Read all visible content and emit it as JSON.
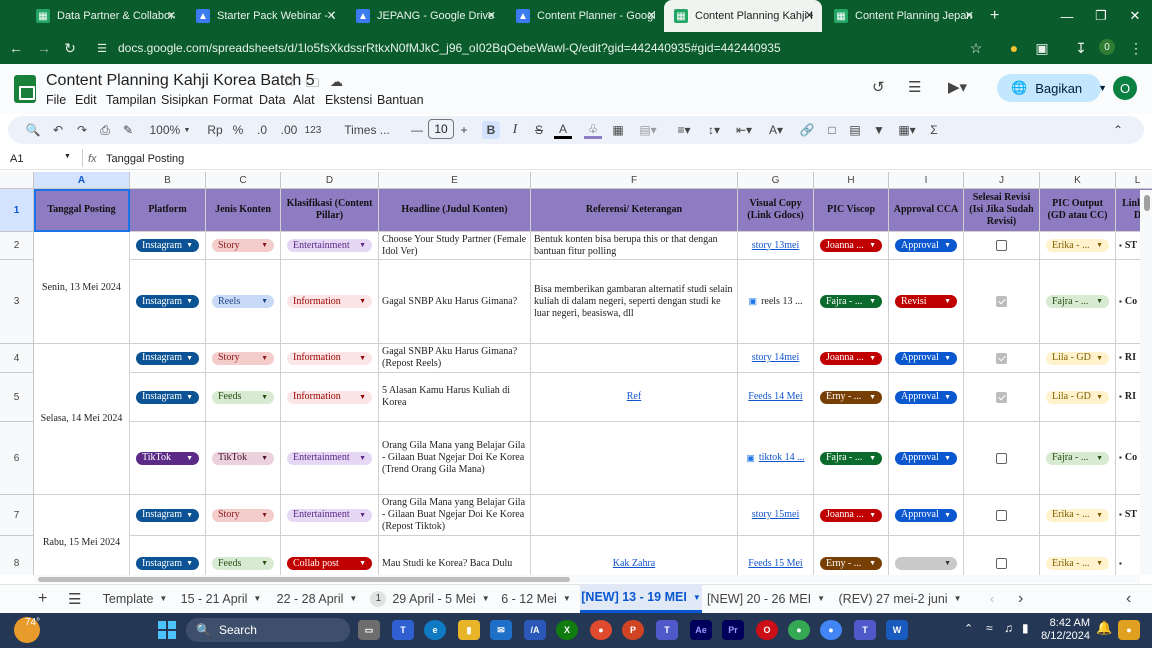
{
  "browser": {
    "tabs": [
      {
        "title": "Data Partner & Collaborat",
        "active": false,
        "icon": "sheets-icon"
      },
      {
        "title": "Starter Pack Webinar - Go",
        "active": false,
        "icon": "drive-icon"
      },
      {
        "title": "JEPANG - Google Drive",
        "active": false,
        "icon": "drive-icon"
      },
      {
        "title": "Content Planner - Google",
        "active": false,
        "icon": "drive-icon"
      },
      {
        "title": "Content Planning Kahji Ko",
        "active": true,
        "icon": "sheets-icon"
      },
      {
        "title": "Content Planning Jepang",
        "active": false,
        "icon": "sheets-icon"
      }
    ],
    "new_tab_symbol": "+",
    "url": "docs.google.com/spreadsheets/d/1lo5fsXkdssrRtkxN0fMJkC_j96_oI02BqOebeWawl-Q/edit?gid=442440935#gid=442440935",
    "profile_initial": "0"
  },
  "doc": {
    "title": "Content Planning Kahji Korea Batch 5",
    "menu": [
      "File",
      "Edit",
      "Tampilan",
      "Sisipkan",
      "Format",
      "Data",
      "Alat",
      "Ekstensi",
      "Bantuan"
    ],
    "share_label": "Bagikan",
    "avatar_initial": "O"
  },
  "toolbar": {
    "zoom": "100%",
    "currency": "Rp",
    "percent": "%",
    "dec_decrease": ".0",
    "dec_increase": ".00",
    "number_format": "123",
    "font": "Times ...",
    "font_size": "10"
  },
  "formula_bar": {
    "cell_ref": "A1",
    "fx": "fx",
    "value": "Tanggal Posting"
  },
  "grid": {
    "columns": [
      "A",
      "B",
      "C",
      "D",
      "E",
      "F",
      "G",
      "H",
      "I",
      "J",
      "K",
      "L"
    ],
    "row_numbers": [
      "1",
      "2",
      "3",
      "4",
      "5",
      "6",
      "7",
      "8"
    ],
    "headers": [
      "Tanggal Posting",
      "Platform",
      "Jenis Konten",
      "Klasifikasi (Content Pillar)",
      "Headline (Judul Konten)",
      "Referensi/ Keterangan",
      "Visual Copy (Link Gdocs)",
      "PIC Viscop",
      "Approval CCA",
      "Selesai Revisi (Isi Jika Sudah Revisi)",
      "PIC Output (GD atau CC)",
      "Link G D"
    ],
    "dates": [
      "Senin, 13 Mei 2024",
      "Selasa, 14 Mei 2024",
      "Rabu, 15 Mei 2024"
    ],
    "rows": [
      {
        "platform": "Instagram",
        "jenis": "Story",
        "klas": "Entertainment",
        "headline": "Choose Your Study Partner (Female Idol Ver)",
        "ref": "Bentuk konten bisa berupa this or that dengan bantuan fitur polling",
        "visual": "story 13mei",
        "pic": "Joanna ...",
        "approval": "Approval",
        "done": false,
        "output": "Erika - ...",
        "link": "ST"
      },
      {
        "platform": "Instagram",
        "jenis": "Reels",
        "klas": "Information",
        "headline": "Gagal SNBP Aku Harus Gimana?",
        "ref": "Bisa memberikan gambaran alternatif studi selain kuliah di dalam negeri, seperti dengan studi ke luar negeri, beasiswa, dll",
        "visual": "reels 13 ...",
        "pic": "Fajra - ...",
        "approval": "Revisi",
        "done": true,
        "output": "Fajra - ...",
        "link": "Co"
      },
      {
        "platform": "Instagram",
        "jenis": "Story",
        "klas": "Information",
        "headline": "Gagal SNBP Aku Harus Gimana? (Repost Reels)",
        "ref": "",
        "visual": "story 14mei",
        "pic": "Joanna ...",
        "approval": "Approval",
        "done": true,
        "output": "Lila - GD",
        "link": "RI"
      },
      {
        "platform": "Instagram",
        "jenis": "Feeds",
        "klas": "Information",
        "headline": "5 Alasan Kamu Harus Kuliah di Korea",
        "ref": "Ref",
        "visual": "Feeds 14 Mei",
        "pic": "Erny - ...",
        "approval": "Approval",
        "done": true,
        "output": "Lila - GD",
        "link": "RI"
      },
      {
        "platform": "TikTok",
        "jenis": "TikTok",
        "klas": "Entertainment",
        "headline": "Orang Gila Mana yang Belajar Gila - Gilaan Buat Ngejar Doi Ke Korea (Trend Orang Gila Mana)",
        "ref": "",
        "visual": "tiktok 14 ...",
        "pic": "Fajra - ...",
        "approval": "Approval",
        "done": false,
        "output": "Fajra - ...",
        "link": "Co"
      },
      {
        "platform": "Instagram",
        "jenis": "Story",
        "klas": "Entertainment",
        "headline": "Orang Gila Mana yang Belajar Gila - Gilaan Buat Ngejar Doi Ke Korea (Repost Tiktok)",
        "ref": "",
        "visual": "story 15mei",
        "pic": "Joanna ...",
        "approval": "Approval",
        "done": false,
        "output": "Erika - ...",
        "link": "ST"
      },
      {
        "platform": "Instagram",
        "jenis": "Feeds",
        "klas": "Collab post",
        "headline": "Mau Studi ke Korea? Baca Dulu",
        "ref": "Kak Zahra",
        "visual": "Feeds 15 Mei",
        "pic": "Erny - ...",
        "approval": "",
        "done": false,
        "output": "Erika - ...",
        "link": ""
      }
    ]
  },
  "sheets": {
    "tabs": [
      {
        "label": "Template",
        "active": false
      },
      {
        "label": "15 - 21 April",
        "active": false
      },
      {
        "label": "22 - 28 April",
        "active": false
      },
      {
        "label": "29 April - 5 Mei",
        "active": false,
        "badge": "1"
      },
      {
        "label": "6 - 12 Mei",
        "active": false
      },
      {
        "label": "[NEW] 13 - 19 MEI",
        "active": true
      },
      {
        "label": "[NEW] 20 - 26 MEI",
        "active": false
      },
      {
        "label": "(REV) 27 mei-2 juni",
        "active": false
      }
    ]
  },
  "taskbar": {
    "weather_temp": "74°",
    "search_label": "Search",
    "time": "8:42 AM",
    "date": "8/12/2024"
  },
  "colors": {
    "header_fill": "#8e7cc3",
    "browser_green": "#0b5c2c",
    "instagram_chip": "#0b5394",
    "tiktok_chip": "#5b2a86",
    "approval_chip": "#0b57d0",
    "revisi_chip": "#c00000"
  }
}
